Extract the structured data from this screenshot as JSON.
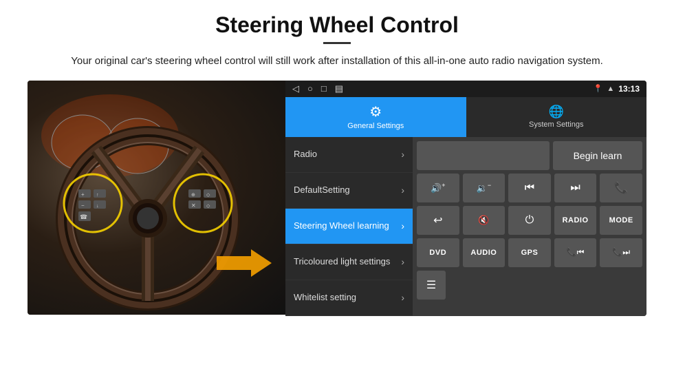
{
  "page": {
    "title": "Steering Wheel Control",
    "subtitle": "Your original car's steering wheel control will still work after installation of this all-in-one auto radio navigation system.",
    "divider_visible": true
  },
  "status_bar": {
    "time": "13:13",
    "icons": [
      "◁",
      "○",
      "□",
      "▤"
    ]
  },
  "tabs": [
    {
      "id": "general",
      "label": "General Settings",
      "icon": "⚙",
      "active": true
    },
    {
      "id": "system",
      "label": "System Settings",
      "icon": "🌐",
      "active": false
    }
  ],
  "menu_items": [
    {
      "id": "radio",
      "label": "Radio",
      "active": false
    },
    {
      "id": "default",
      "label": "DefaultSetting",
      "active": false
    },
    {
      "id": "steering",
      "label": "Steering Wheel learning",
      "active": true
    },
    {
      "id": "tricoloured",
      "label": "Tricoloured light settings",
      "active": false
    },
    {
      "id": "whitelist",
      "label": "Whitelist setting",
      "active": false
    }
  ],
  "control_panel": {
    "begin_learn_label": "Begin learn",
    "rows": [
      {
        "buttons": [
          {
            "id": "vol-up",
            "icon": "🔊+",
            "type": "icon"
          },
          {
            "id": "vol-down",
            "icon": "🔉−",
            "type": "icon"
          },
          {
            "id": "prev-track",
            "icon": "⏮",
            "type": "icon"
          },
          {
            "id": "next-track",
            "icon": "⏭",
            "type": "icon"
          },
          {
            "id": "phone",
            "icon": "📞",
            "type": "icon"
          }
        ]
      },
      {
        "buttons": [
          {
            "id": "hang-up",
            "icon": "📵",
            "type": "icon"
          },
          {
            "id": "mute",
            "icon": "🔇×",
            "type": "icon"
          },
          {
            "id": "power",
            "icon": "⏻",
            "type": "icon"
          },
          {
            "id": "radio-btn",
            "label": "RADIO",
            "type": "text"
          },
          {
            "id": "mode-btn",
            "label": "MODE",
            "type": "text"
          }
        ]
      },
      {
        "buttons": [
          {
            "id": "dvd-btn",
            "label": "DVD",
            "type": "text"
          },
          {
            "id": "audio-btn",
            "label": "AUDIO",
            "type": "text"
          },
          {
            "id": "gps-btn",
            "label": "GPS",
            "type": "text"
          },
          {
            "id": "phone-prev",
            "icon": "📞⏮",
            "type": "icon"
          },
          {
            "id": "phone-next",
            "icon": "📞⏭",
            "type": "icon"
          }
        ]
      }
    ],
    "whitelist_icon": "≡"
  }
}
